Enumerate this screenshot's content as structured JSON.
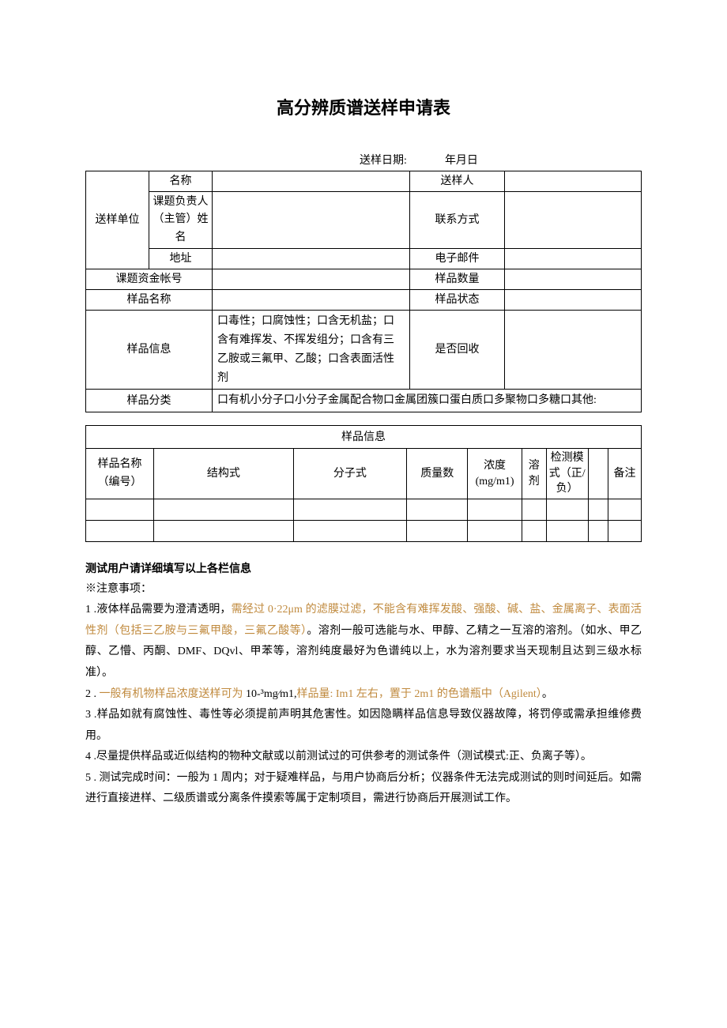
{
  "title": "高分辨质谱送样申请表",
  "date_label": "送样日期:",
  "date_suffix": "年月日",
  "table1": {
    "unit_label": "送样单位",
    "name_label": "名称",
    "sender_label": "送样人",
    "pi_label": "课题负责人（主管）姓名",
    "contact_label": "联系方式",
    "address_label": "地址",
    "email_label": "电子邮件",
    "fund_label": "课题资金帐号",
    "count_label": "样品数量",
    "sample_name_label": "样品名称",
    "state_label": "样品状态",
    "info_label": "样品信息",
    "info_choices": "口毒性；口腐蚀性；口含无机盐；口含有难挥发、不挥发组分；口含有三乙胺或三氟甲、乙酸；口含表面活性剂",
    "recycle_label": "是否回收",
    "class_label": "样品分类",
    "class_choices": "口有机小分子口小分子金属配合物口金属团簇口蛋白质口多聚物口多糖口其他:"
  },
  "table2": {
    "title": "样品信息",
    "cols": {
      "name": "样品名称（编号）",
      "structure": "结构式",
      "formula": "分子式",
      "mass": "质量数",
      "conc": "浓度(mg/m1)",
      "solvent": "溶剂",
      "mode": "检测模式（正/负）",
      "remark": "备注"
    }
  },
  "notes": {
    "bold": "测试用户请详细填写以上各栏信息",
    "attn": "※注意事项：",
    "n1a": "1  .液体样品需要为澄清透明，",
    "n1b": "需经过 0·22μm 的滤膜过滤，不能含有难挥发酸、强酸、碱、盐、金属离子、表面活性剂（包括三乙胺与三氟甲酸，三氟乙酸等）",
    "n1c": "。溶剂一般可选能与水、甲醇、乙精之一互溶的溶剂。（如水、甲乙醇、乙懵、丙酮、DMF、DQvl、甲苯等，溶剂纯度最好为色谱纯以上，水为溶剂要求当天现制且达到三级水标准）。",
    "n2a": "2  . ",
    "n2b": "一般有机物样品浓度送样可为",
    "n2c": " 10-³mg∕m1,",
    "n2d": "样品量: Im1 左右，置于 2m1 的色谱瓶中（Agilent）",
    "n2e": "。",
    "n3": "3  .样品如就有腐蚀性、毒性等必须提前声明其危害性。如因隐瞒样品信息导致仪器故障，将罚停或需承担维修费用。",
    "n4": "4  .尽量提供样品或近似结构的物种文献或以前测试过的可供参考的测试条件（测试模式:正、负离子等）。",
    "n5": "5  . 测试完成时间：一般为 1 周内；对于疑难样品，与用户协商后分析；仪器条件无法完成测试的则时间延后。如需进行直接进样、二级质谱或分离条件摸索等属于定制项目，需进行协商后开展测试工作。"
  }
}
